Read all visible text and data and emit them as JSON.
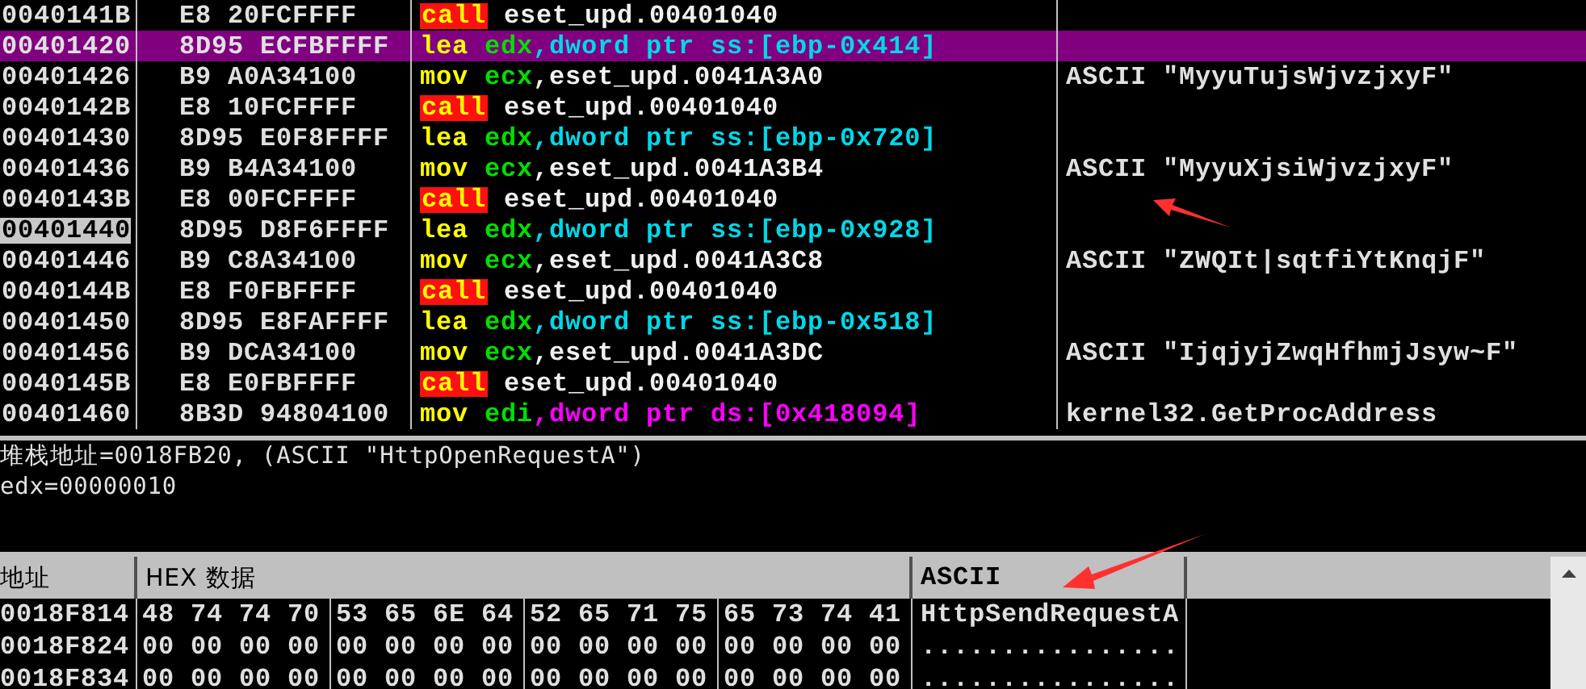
{
  "disassembly": {
    "rows": [
      {
        "address": "0040141B",
        "current": false,
        "selected": false,
        "hex": "E8 20FCFFFF",
        "mnemonic": "call",
        "kind": "call",
        "operands": [
          {
            "text": "eset_upd.00401040",
            "kind": "plain"
          }
        ],
        "comment": ""
      },
      {
        "address": "00401420",
        "current": false,
        "selected": true,
        "hex": "8D95 ECFBFFFF",
        "mnemonic": "lea",
        "kind": "normal",
        "operands": [
          {
            "text": "edx",
            "kind": "register"
          },
          {
            "text": ",dword ptr ss:[ebp-0x414]",
            "kind": "stack"
          }
        ],
        "comment": ""
      },
      {
        "address": "00401426",
        "current": false,
        "selected": false,
        "hex": "B9 A0A34100",
        "mnemonic": "mov",
        "kind": "normal",
        "operands": [
          {
            "text": "ecx",
            "kind": "register"
          },
          {
            "text": ",eset_upd.0041A3A0",
            "kind": "plain"
          }
        ],
        "comment": "ASCII \"MyyuTujsWjvzjxyF\""
      },
      {
        "address": "0040142B",
        "current": false,
        "selected": false,
        "hex": "E8 10FCFFFF",
        "mnemonic": "call",
        "kind": "call",
        "operands": [
          {
            "text": "eset_upd.00401040",
            "kind": "plain"
          }
        ],
        "comment": ""
      },
      {
        "address": "00401430",
        "current": false,
        "selected": false,
        "hex": "8D95 E0F8FFFF",
        "mnemonic": "lea",
        "kind": "normal",
        "operands": [
          {
            "text": "edx",
            "kind": "register"
          },
          {
            "text": ",dword ptr ss:[ebp-0x720]",
            "kind": "stack"
          }
        ],
        "comment": ""
      },
      {
        "address": "00401436",
        "current": false,
        "selected": false,
        "hex": "B9 B4A34100",
        "mnemonic": "mov",
        "kind": "normal",
        "operands": [
          {
            "text": "ecx",
            "kind": "register"
          },
          {
            "text": ",eset_upd.0041A3B4",
            "kind": "plain"
          }
        ],
        "comment": "ASCII \"MyyuXjsiWjvzjxyF\""
      },
      {
        "address": "0040143B",
        "current": false,
        "selected": false,
        "hex": "E8 00FCFFFF",
        "mnemonic": "call",
        "kind": "call",
        "operands": [
          {
            "text": "eset_upd.00401040",
            "kind": "plain"
          }
        ],
        "comment": ""
      },
      {
        "address": "00401440",
        "current": true,
        "selected": false,
        "hex": "8D95 D8F6FFFF",
        "mnemonic": "lea",
        "kind": "normal",
        "operands": [
          {
            "text": "edx",
            "kind": "register"
          },
          {
            "text": ",dword ptr ss:[ebp-0x928]",
            "kind": "stack"
          }
        ],
        "comment": ""
      },
      {
        "address": "00401446",
        "current": false,
        "selected": false,
        "hex": "B9 C8A34100",
        "mnemonic": "mov",
        "kind": "normal",
        "operands": [
          {
            "text": "ecx",
            "kind": "register"
          },
          {
            "text": ",eset_upd.0041A3C8",
            "kind": "plain"
          }
        ],
        "comment": "ASCII \"ZWQIt|sqtfiYtKnqjF\""
      },
      {
        "address": "0040144B",
        "current": false,
        "selected": false,
        "hex": "E8 F0FBFFFF",
        "mnemonic": "call",
        "kind": "call",
        "operands": [
          {
            "text": "eset_upd.00401040",
            "kind": "plain"
          }
        ],
        "comment": ""
      },
      {
        "address": "00401450",
        "current": false,
        "selected": false,
        "hex": "8D95 E8FAFFFF",
        "mnemonic": "lea",
        "kind": "normal",
        "operands": [
          {
            "text": "edx",
            "kind": "register"
          },
          {
            "text": ",dword ptr ss:[ebp-0x518]",
            "kind": "stack"
          }
        ],
        "comment": ""
      },
      {
        "address": "00401456",
        "current": false,
        "selected": false,
        "hex": "B9 DCA34100",
        "mnemonic": "mov",
        "kind": "normal",
        "operands": [
          {
            "text": "ecx",
            "kind": "register"
          },
          {
            "text": ",eset_upd.0041A3DC",
            "kind": "plain"
          }
        ],
        "comment": "ASCII \"IjqjyjZwqHfhmjJsyw~F\""
      },
      {
        "address": "0040145B",
        "current": false,
        "selected": false,
        "hex": "E8 E0FBFFFF",
        "mnemonic": "call",
        "kind": "call",
        "operands": [
          {
            "text": "eset_upd.00401040",
            "kind": "plain"
          }
        ],
        "comment": ""
      },
      {
        "address": "00401460",
        "current": false,
        "selected": false,
        "hex": "8B3D 94804100",
        "mnemonic": "mov",
        "kind": "normal",
        "operands": [
          {
            "text": "edi",
            "kind": "register"
          },
          {
            "text": ",dword ptr ds:[0x418094]",
            "kind": "data"
          }
        ],
        "comment": "kernel32.GetProcAddress"
      }
    ]
  },
  "info": {
    "lines": [
      "堆栈地址=0018FB20, (ASCII \"HttpOpenRequestA\")",
      "edx=00000010"
    ]
  },
  "dump": {
    "columns": [
      "地址",
      "HEX 数据",
      "ASCII"
    ],
    "rows": [
      {
        "address": "0018F814",
        "groups": [
          "48 74 74 70",
          "53 65 6E 64",
          "52 65 71 75",
          "65 73 74 41"
        ],
        "ascii": "HttpSendRequestA"
      },
      {
        "address": "0018F824",
        "groups": [
          "00 00 00 00",
          "00 00 00 00",
          "00 00 00 00",
          "00 00 00 00"
        ],
        "ascii": "................"
      },
      {
        "address": "0018F834",
        "groups": [
          "00 00 00 00",
          "00 00 00 00",
          "00 00 00 00",
          "00 00 00 00"
        ],
        "ascii": "................"
      }
    ]
  }
}
